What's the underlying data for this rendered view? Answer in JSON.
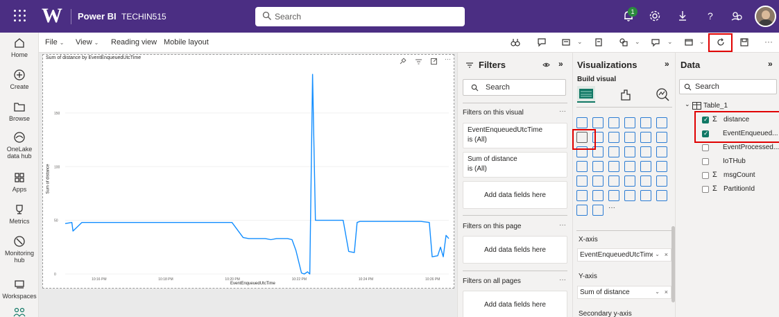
{
  "topbar": {
    "app_name": "Power BI",
    "workspace": "TECHIN515",
    "search_placeholder": "Search",
    "notification_count": "1",
    "brand_color": "#4b2e83"
  },
  "leftnav": {
    "items": [
      {
        "label": "Home",
        "icon": "home-icon"
      },
      {
        "label": "Create",
        "icon": "plus-circle-icon"
      },
      {
        "label": "Browse",
        "icon": "folder-icon"
      },
      {
        "label": "OneLake data hub",
        "icon": "onelake-icon"
      },
      {
        "label": "Apps",
        "icon": "apps-icon"
      },
      {
        "label": "Metrics",
        "icon": "trophy-icon"
      },
      {
        "label": "Monitoring hub",
        "icon": "monitor-icon"
      },
      {
        "label": "Workspaces",
        "icon": "workspaces-icon"
      }
    ]
  },
  "ribbon": {
    "file": "File",
    "view": "View",
    "reading_view": "Reading view",
    "mobile_layout": "Mobile layout"
  },
  "visual": {
    "title": "Sum of distance by EventEnqueuedUtcTime",
    "y_label": "Sum of distance",
    "x_label": "EventEnqueuedUtcTime"
  },
  "chart_data": {
    "type": "line",
    "title": "Sum of distance by EventEnqueuedUtcTime",
    "xlabel": "EventEnqueuedUtcTime",
    "ylabel": "Sum of distance",
    "x_ticks": [
      "10:16 PM",
      "10:18 PM",
      "10:20 PM",
      "10:22 PM",
      "10:24 PM",
      "10:26 PM"
    ],
    "y_ticks": [
      "0",
      "50",
      "100",
      "150"
    ],
    "ylim": [
      0,
      190
    ],
    "line_color": "#118dff",
    "series": [
      {
        "x": [
          "10:15:00 PM",
          "10:15:12 PM",
          "10:15:14 PM",
          "10:15:30 PM",
          "10:16:00 PM",
          "10:16:30 PM",
          "10:17:00 PM",
          "10:17:30 PM",
          "10:18:00 PM",
          "10:18:30 PM",
          "10:19:00 PM",
          "10:19:30 PM",
          "10:20:00 PM",
          "10:20:20 PM",
          "10:20:30 PM",
          "10:20:45 PM",
          "10:21:00 PM",
          "10:21:10 PM",
          "10:21:20 PM",
          "10:21:30 PM",
          "10:21:40 PM",
          "10:21:48 PM",
          "10:21:55 PM",
          "10:22:05 PM",
          "10:22:10 PM",
          "10:22:16 PM",
          "10:22:20 PM",
          "10:22:25 PM",
          "10:22:30 PM",
          "10:23:00 PM",
          "10:23:20 PM",
          "10:23:30 PM",
          "10:23:40 PM",
          "10:23:45 PM",
          "10:23:50 PM",
          "10:24:00 PM",
          "10:24:30 PM",
          "10:25:00 PM",
          "10:25:20 PM",
          "10:25:40 PM",
          "10:25:55 PM",
          "10:26:00 PM",
          "10:26:10 PM",
          "10:26:15 PM",
          "10:26:20 PM",
          "10:26:25 PM",
          "10:26:30 PM"
        ],
        "values": [
          47,
          48,
          40,
          48,
          48,
          48,
          48,
          48,
          48,
          48,
          48,
          48,
          48,
          34,
          33,
          33,
          33,
          32,
          33,
          33,
          33,
          32,
          22,
          1,
          0,
          2,
          0,
          186,
          50,
          50,
          50,
          21,
          20,
          48,
          49,
          49,
          49,
          49,
          49,
          49,
          48,
          16,
          17,
          25,
          16,
          36,
          33
        ]
      }
    ]
  },
  "filters": {
    "title": "Filters",
    "search_placeholder": "Search",
    "on_visual": "Filters on this visual",
    "card1_field": "EventEnqueuedUtcTime",
    "card1_value": "is (All)",
    "card2_field": "Sum of distance",
    "card2_value": "is (All)",
    "add_fields": "Add data fields here",
    "on_page": "Filters on this page",
    "on_all_pages": "Filters on all pages"
  },
  "visualizations": {
    "title": "Visualizations",
    "build_visual": "Build visual",
    "x_axis_title": "X-axis",
    "x_axis_field": "EventEnqueuedUtcTime",
    "y_axis_title": "Y-axis",
    "y_axis_field": "Sum of distance",
    "secondary_title": "Secondary y-axis"
  },
  "data": {
    "title": "Data",
    "search_placeholder": "Search",
    "table_name": "Table_1",
    "fields": [
      {
        "name": "distance",
        "checked": true,
        "sigma": true
      },
      {
        "name": "EventEnqueued...",
        "checked": true,
        "sigma": false
      },
      {
        "name": "EventProcessed...",
        "checked": false,
        "sigma": false
      },
      {
        "name": "IoTHub",
        "checked": false,
        "sigma": false
      },
      {
        "name": "msgCount",
        "checked": false,
        "sigma": true
      },
      {
        "name": "PartitionId",
        "checked": false,
        "sigma": true
      }
    ]
  }
}
